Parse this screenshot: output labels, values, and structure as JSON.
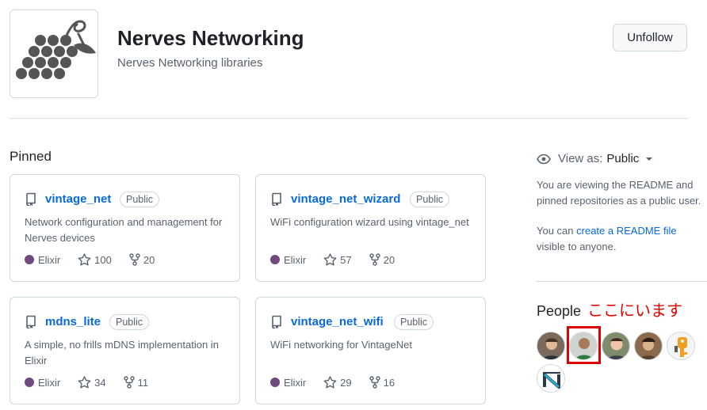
{
  "org": {
    "name": "Nerves Networking",
    "description": "Nerves Networking libraries",
    "logo_icon": "grapes-icon",
    "unfollow_label": "Unfollow"
  },
  "pinned": {
    "title": "Pinned",
    "repos": [
      {
        "name": "vintage_net",
        "visibility": "Public",
        "description": "Network configuration and management for Nerves devices",
        "language": "Elixir",
        "stars": "100",
        "forks": "20"
      },
      {
        "name": "vintage_net_wizard",
        "visibility": "Public",
        "description": "WiFi configuration wizard using vintage_net",
        "language": "Elixir",
        "stars": "57",
        "forks": "20"
      },
      {
        "name": "mdns_lite",
        "visibility": "Public",
        "description": "A simple, no frills mDNS implementation in Elixir",
        "language": "Elixir",
        "stars": "34",
        "forks": "11"
      },
      {
        "name": "vintage_net_wifi",
        "visibility": "Public",
        "description": "WiFi networking for VintageNet",
        "language": "Elixir",
        "stars": "29",
        "forks": "16"
      }
    ]
  },
  "sidebar": {
    "view_as_label": "View as:",
    "view_as_value": "Public",
    "readme_note": "You are viewing the README and pinned repositories as a public user.",
    "create_prefix": "You can",
    "create_link": "create a README file",
    "create_suffix": "visible to anyone.",
    "people_title": "People",
    "people_annotation": "ここにいます"
  },
  "colors": {
    "elixir": "#6e4a7e",
    "link": "#0969da",
    "highlight": "#e00000"
  }
}
